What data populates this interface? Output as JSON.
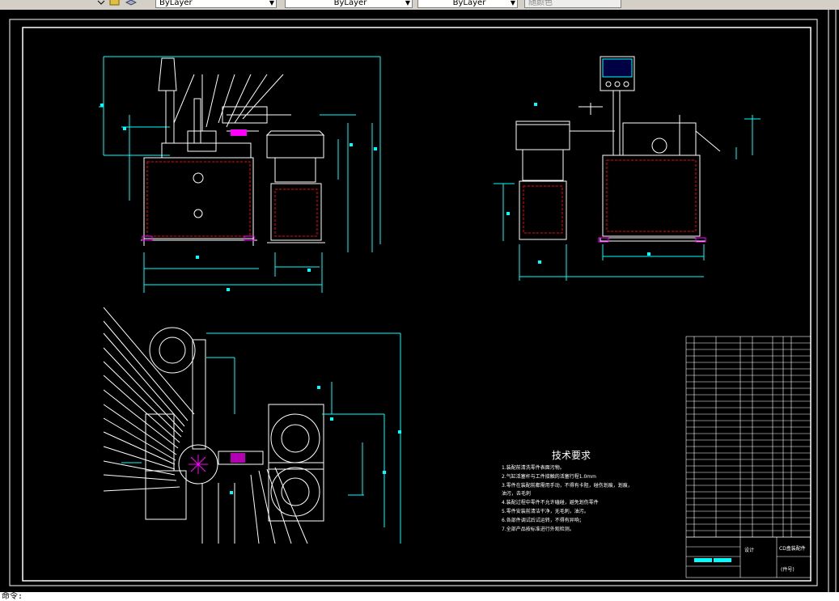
{
  "toolbar": {
    "layer_color": "ByLayer",
    "linetype": "ByLayer",
    "lineweight": "ByLayer",
    "plot_style": "随颜色"
  },
  "drawing": {
    "tech_title": "技术要求",
    "tech_items": [
      "1.装配前清洗零件表面污物。",
      "2.气缸活塞杆与工件接触的活塞行程1.0mm",
      "3.零件在装配前都需用手动，不得有卡阻，碰伤划痕，划痕，",
      "  油污，去毛刺",
      "4.装配过程中零件不允许磕碰，避免划伤零件",
      "5.零件安装前清洁干净，无毛刺，油污。",
      "6.各部件调试后试运转，不得有异响；",
      "7.全部产品按标准进行外观检测。"
    ],
    "title_block": {
      "design_label": "设计",
      "drawing_name": "CD盒装配件",
      "material": "(件号)"
    },
    "colors": {
      "background": "#000000",
      "frame": "#ffffff",
      "dimension": "#00ffff",
      "hidden": "#ff0000",
      "accent": "#ff00ff"
    }
  },
  "status": {
    "command_line": "命令:"
  }
}
